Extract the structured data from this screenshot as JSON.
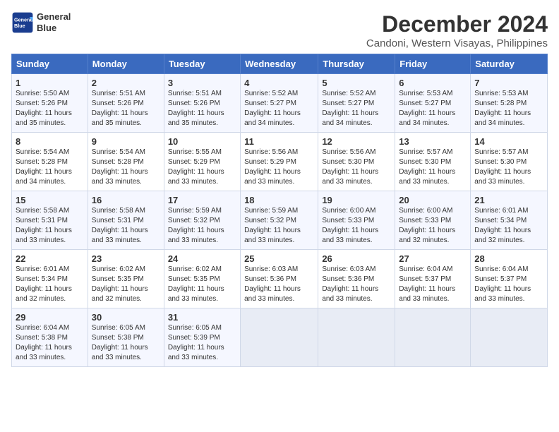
{
  "logo": {
    "line1": "General",
    "line2": "Blue"
  },
  "title": "December 2024",
  "subtitle": "Candoni, Western Visayas, Philippines",
  "days_of_week": [
    "Sunday",
    "Monday",
    "Tuesday",
    "Wednesday",
    "Thursday",
    "Friday",
    "Saturday"
  ],
  "weeks": [
    [
      {
        "day": "1",
        "sunrise": "5:50 AM",
        "sunset": "5:26 PM",
        "daylight": "11 hours and 35 minutes."
      },
      {
        "day": "2",
        "sunrise": "5:51 AM",
        "sunset": "5:26 PM",
        "daylight": "11 hours and 35 minutes."
      },
      {
        "day": "3",
        "sunrise": "5:51 AM",
        "sunset": "5:26 PM",
        "daylight": "11 hours and 35 minutes."
      },
      {
        "day": "4",
        "sunrise": "5:52 AM",
        "sunset": "5:27 PM",
        "daylight": "11 hours and 34 minutes."
      },
      {
        "day": "5",
        "sunrise": "5:52 AM",
        "sunset": "5:27 PM",
        "daylight": "11 hours and 34 minutes."
      },
      {
        "day": "6",
        "sunrise": "5:53 AM",
        "sunset": "5:27 PM",
        "daylight": "11 hours and 34 minutes."
      },
      {
        "day": "7",
        "sunrise": "5:53 AM",
        "sunset": "5:28 PM",
        "daylight": "11 hours and 34 minutes."
      }
    ],
    [
      {
        "day": "8",
        "sunrise": "5:54 AM",
        "sunset": "5:28 PM",
        "daylight": "11 hours and 34 minutes."
      },
      {
        "day": "9",
        "sunrise": "5:54 AM",
        "sunset": "5:28 PM",
        "daylight": "11 hours and 33 minutes."
      },
      {
        "day": "10",
        "sunrise": "5:55 AM",
        "sunset": "5:29 PM",
        "daylight": "11 hours and 33 minutes."
      },
      {
        "day": "11",
        "sunrise": "5:56 AM",
        "sunset": "5:29 PM",
        "daylight": "11 hours and 33 minutes."
      },
      {
        "day": "12",
        "sunrise": "5:56 AM",
        "sunset": "5:30 PM",
        "daylight": "11 hours and 33 minutes."
      },
      {
        "day": "13",
        "sunrise": "5:57 AM",
        "sunset": "5:30 PM",
        "daylight": "11 hours and 33 minutes."
      },
      {
        "day": "14",
        "sunrise": "5:57 AM",
        "sunset": "5:30 PM",
        "daylight": "11 hours and 33 minutes."
      }
    ],
    [
      {
        "day": "15",
        "sunrise": "5:58 AM",
        "sunset": "5:31 PM",
        "daylight": "11 hours and 33 minutes."
      },
      {
        "day": "16",
        "sunrise": "5:58 AM",
        "sunset": "5:31 PM",
        "daylight": "11 hours and 33 minutes."
      },
      {
        "day": "17",
        "sunrise": "5:59 AM",
        "sunset": "5:32 PM",
        "daylight": "11 hours and 33 minutes."
      },
      {
        "day": "18",
        "sunrise": "5:59 AM",
        "sunset": "5:32 PM",
        "daylight": "11 hours and 33 minutes."
      },
      {
        "day": "19",
        "sunrise": "6:00 AM",
        "sunset": "5:33 PM",
        "daylight": "11 hours and 33 minutes."
      },
      {
        "day": "20",
        "sunrise": "6:00 AM",
        "sunset": "5:33 PM",
        "daylight": "11 hours and 32 minutes."
      },
      {
        "day": "21",
        "sunrise": "6:01 AM",
        "sunset": "5:34 PM",
        "daylight": "11 hours and 32 minutes."
      }
    ],
    [
      {
        "day": "22",
        "sunrise": "6:01 AM",
        "sunset": "5:34 PM",
        "daylight": "11 hours and 32 minutes."
      },
      {
        "day": "23",
        "sunrise": "6:02 AM",
        "sunset": "5:35 PM",
        "daylight": "11 hours and 32 minutes."
      },
      {
        "day": "24",
        "sunrise": "6:02 AM",
        "sunset": "5:35 PM",
        "daylight": "11 hours and 33 minutes."
      },
      {
        "day": "25",
        "sunrise": "6:03 AM",
        "sunset": "5:36 PM",
        "daylight": "11 hours and 33 minutes."
      },
      {
        "day": "26",
        "sunrise": "6:03 AM",
        "sunset": "5:36 PM",
        "daylight": "11 hours and 33 minutes."
      },
      {
        "day": "27",
        "sunrise": "6:04 AM",
        "sunset": "5:37 PM",
        "daylight": "11 hours and 33 minutes."
      },
      {
        "day": "28",
        "sunrise": "6:04 AM",
        "sunset": "5:37 PM",
        "daylight": "11 hours and 33 minutes."
      }
    ],
    [
      {
        "day": "29",
        "sunrise": "6:04 AM",
        "sunset": "5:38 PM",
        "daylight": "11 hours and 33 minutes."
      },
      {
        "day": "30",
        "sunrise": "6:05 AM",
        "sunset": "5:38 PM",
        "daylight": "11 hours and 33 minutes."
      },
      {
        "day": "31",
        "sunrise": "6:05 AM",
        "sunset": "5:39 PM",
        "daylight": "11 hours and 33 minutes."
      },
      null,
      null,
      null,
      null
    ]
  ],
  "labels": {
    "sunrise": "Sunrise:",
    "sunset": "Sunset:",
    "daylight": "Daylight:"
  }
}
